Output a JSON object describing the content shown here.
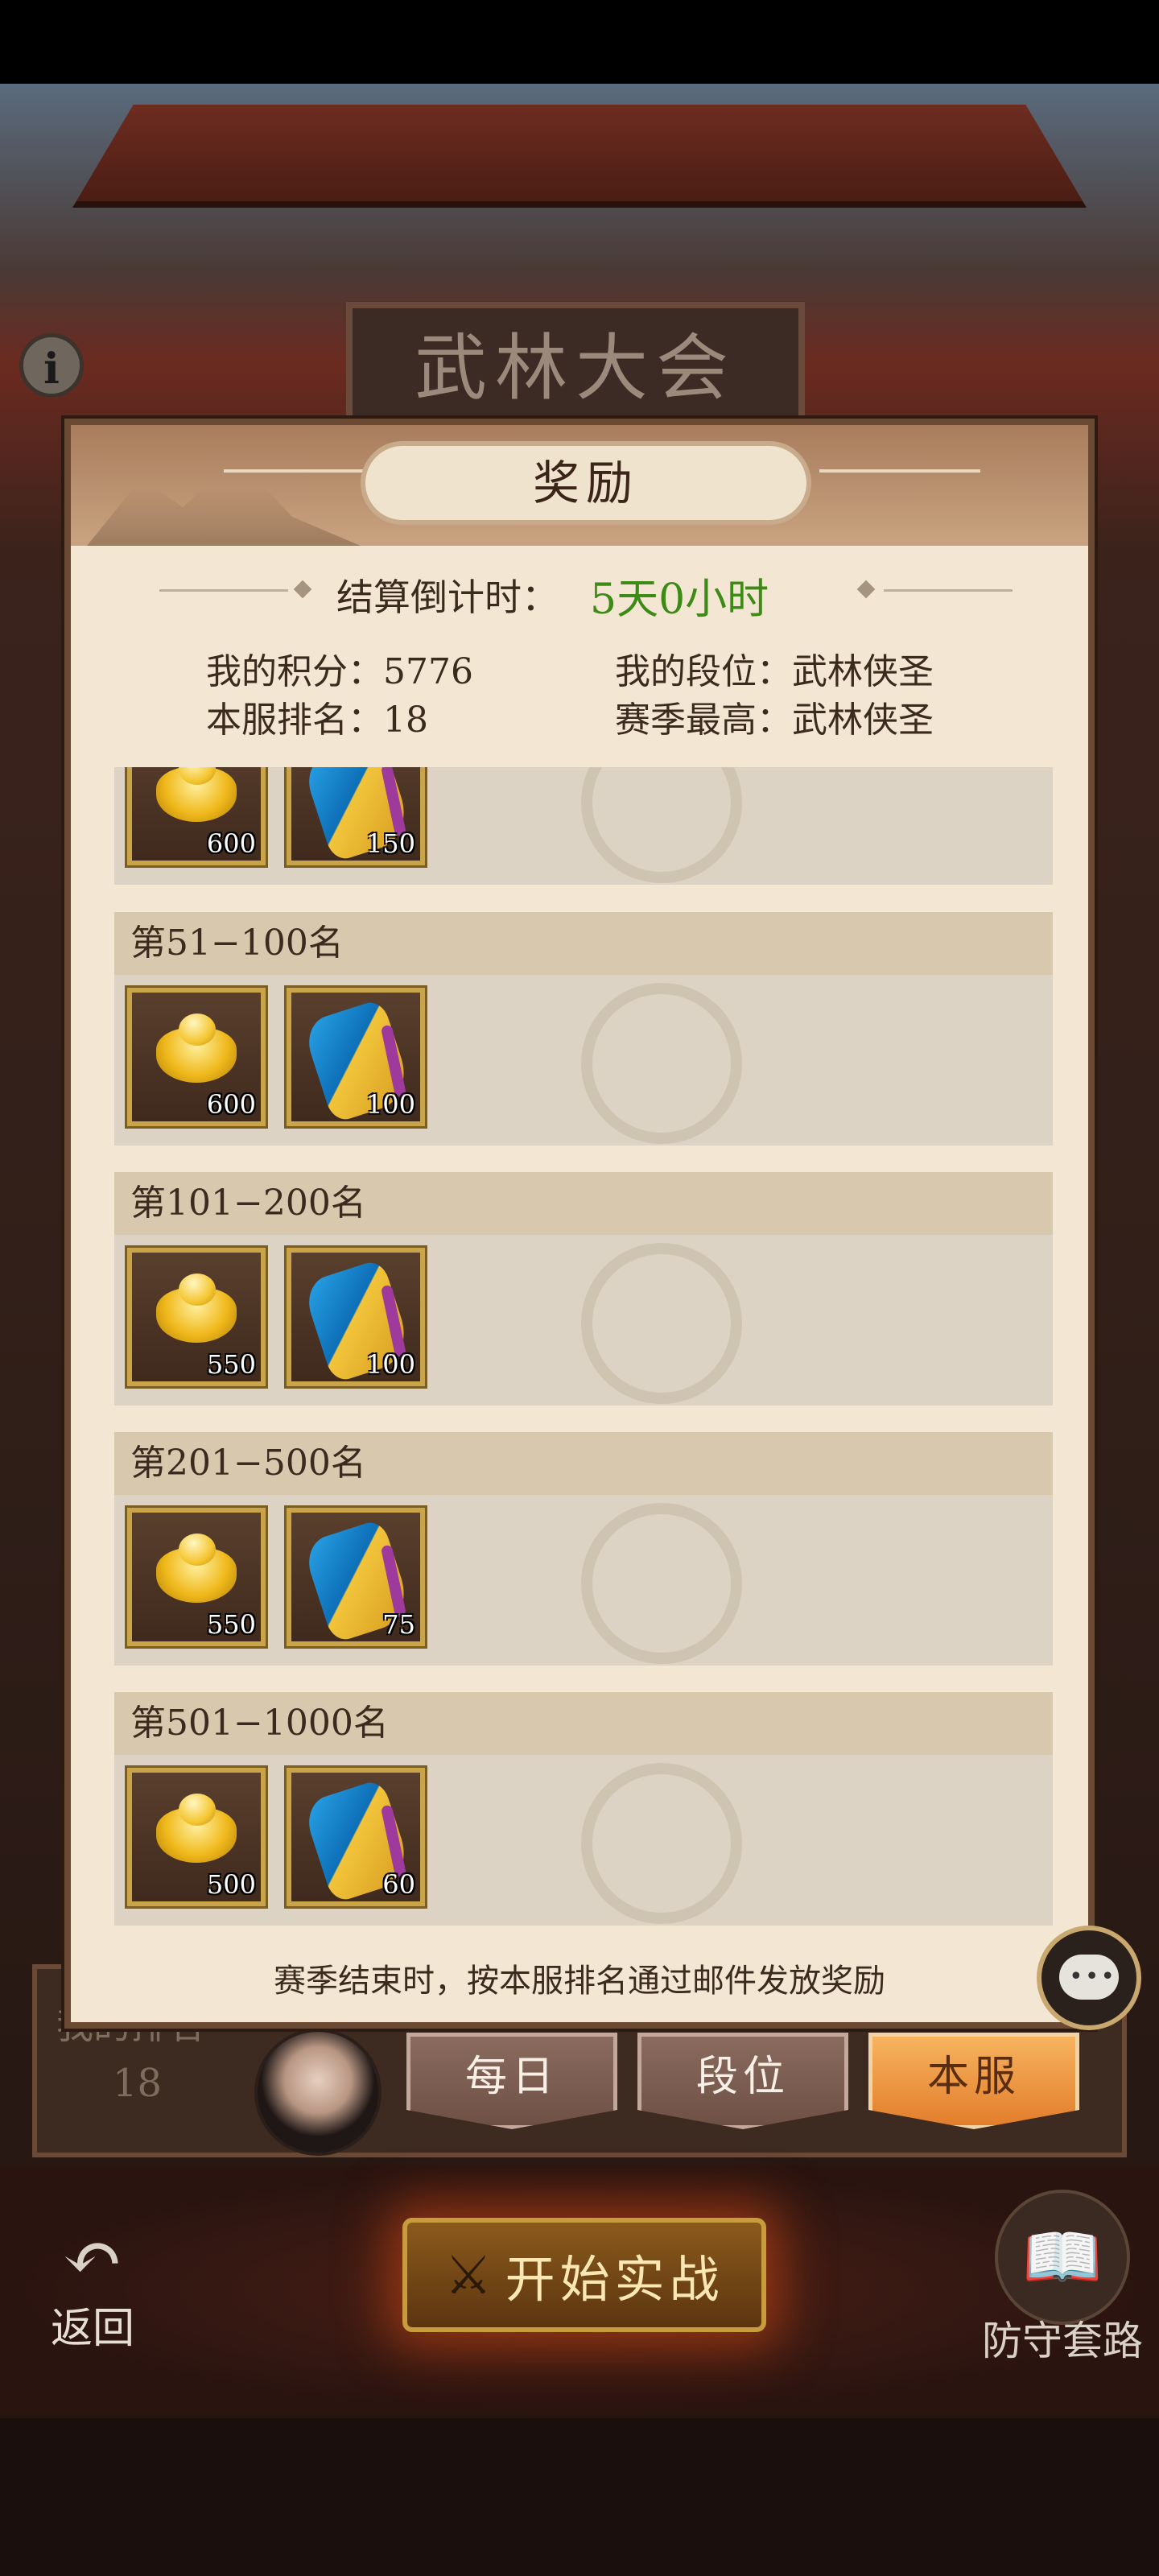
{
  "background": {
    "sign_text": "武林大会",
    "info_icon": "info-icon",
    "my_rank_label": "我的排名",
    "my_rank_value": "18"
  },
  "dialog": {
    "title": "奖励",
    "countdown_label": "结算倒计时：",
    "countdown_value": "5天0小时",
    "stats": {
      "my_score_label": "我的积分：",
      "my_score_value": "5776",
      "my_tier_label": "我的段位：",
      "my_tier_value": "武林侠圣",
      "server_rank_label": "本服排名：",
      "server_rank_value": "18",
      "season_best_label": "赛季最高：",
      "season_best_value": "武林侠圣"
    },
    "tiers": [
      {
        "title": "",
        "items": [
          {
            "icon": "gold-ingot-icon",
            "qty": "600"
          },
          {
            "icon": "token-icon",
            "qty": "150"
          }
        ]
      },
      {
        "title": "第51−100名",
        "items": [
          {
            "icon": "gold-ingot-icon",
            "qty": "600"
          },
          {
            "icon": "token-icon",
            "qty": "100"
          }
        ]
      },
      {
        "title": "第101−200名",
        "items": [
          {
            "icon": "gold-ingot-icon",
            "qty": "550"
          },
          {
            "icon": "token-icon",
            "qty": "100"
          }
        ]
      },
      {
        "title": "第201−500名",
        "items": [
          {
            "icon": "gold-ingot-icon",
            "qty": "550"
          },
          {
            "icon": "token-icon",
            "qty": "75"
          }
        ]
      },
      {
        "title": "第501−1000名",
        "items": [
          {
            "icon": "gold-ingot-icon",
            "qty": "500"
          },
          {
            "icon": "token-icon",
            "qty": "60"
          }
        ]
      }
    ],
    "footer_note": "赛季结束时，按本服排名通过邮件发放奖励"
  },
  "tabs": [
    {
      "label": "每日",
      "active": false
    },
    {
      "label": "段位",
      "active": false
    },
    {
      "label": "本服",
      "active": true
    }
  ],
  "bottom": {
    "back_label": "返回",
    "start_label": "开始实战",
    "defense_label": "防守套路"
  },
  "colors": {
    "countdown": "#3e8a16",
    "active_tab": "#e27e2c",
    "dialog_bg": "#f3e7d4"
  }
}
